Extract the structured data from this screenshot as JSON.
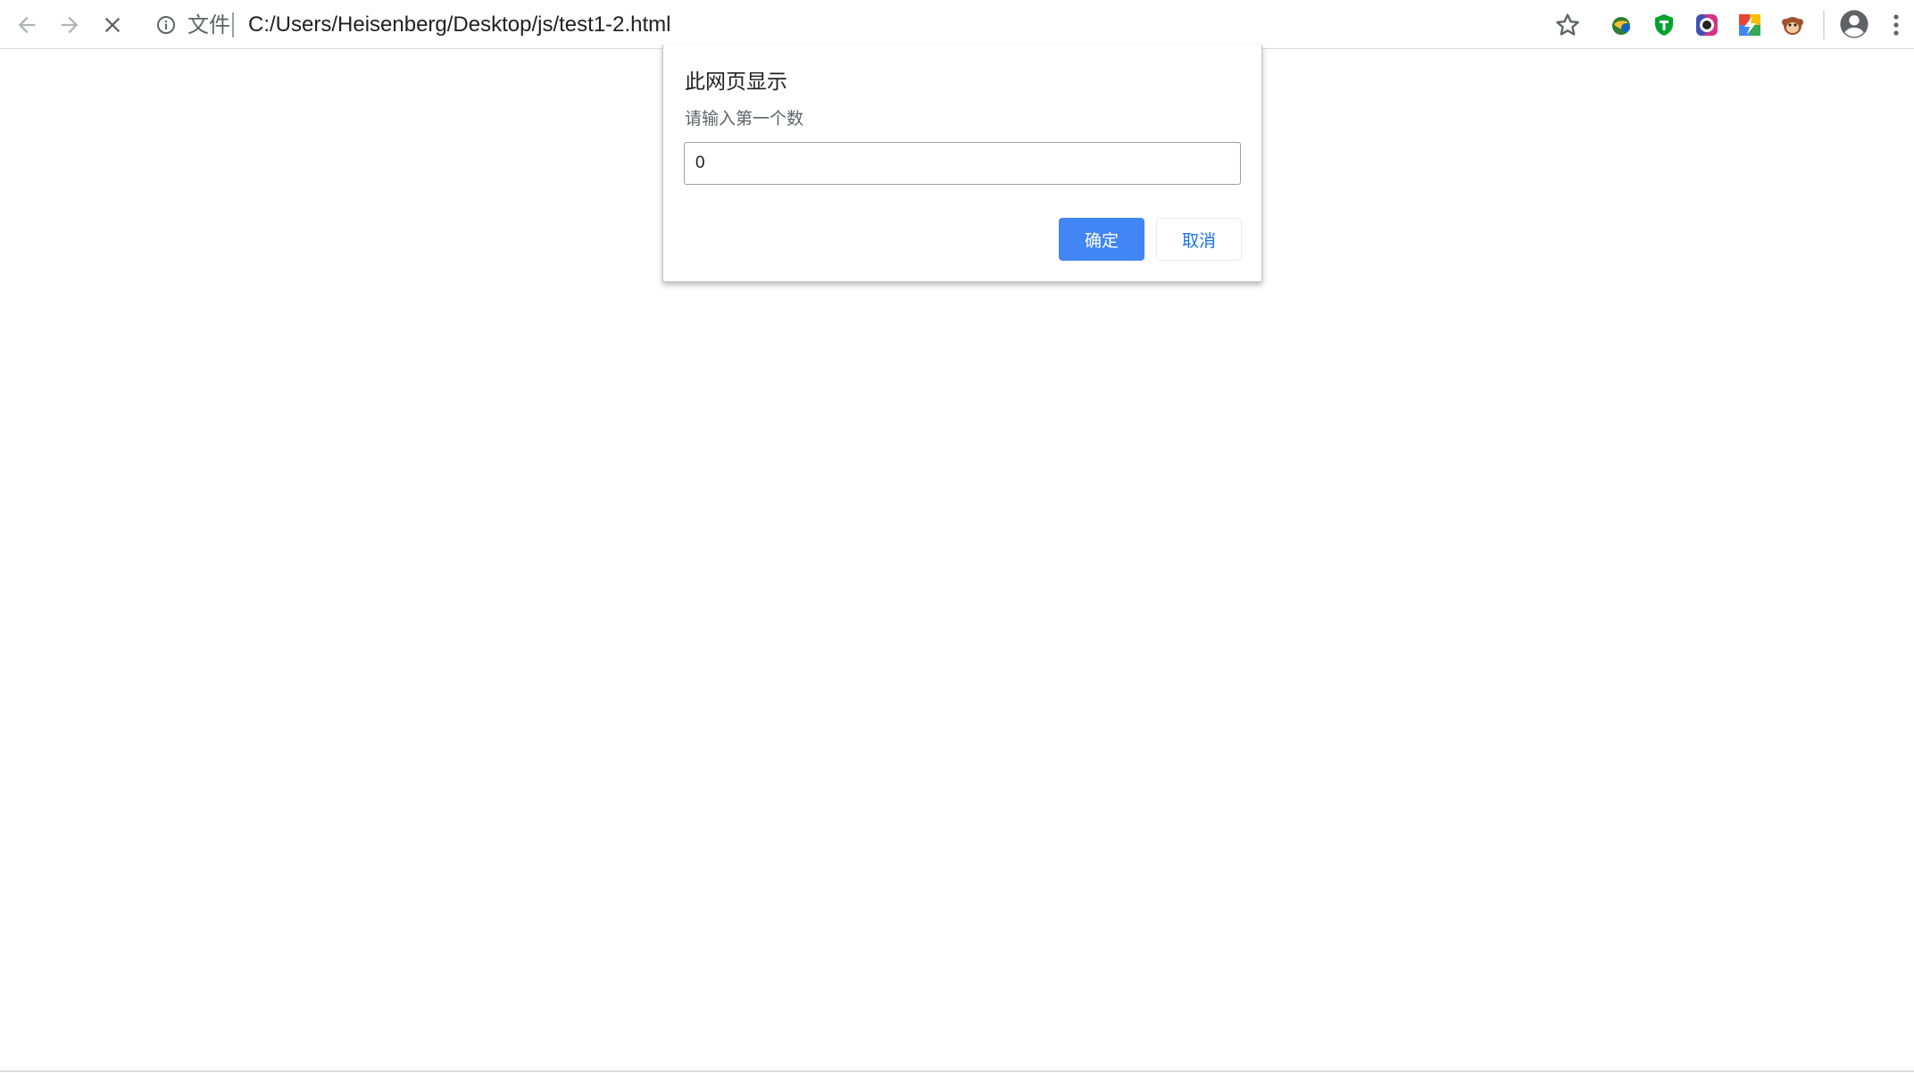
{
  "browser": {
    "url_scheme_label": "文件",
    "url": "C:/Users/Heisenberg/Desktop/js/test1-2.html",
    "nav_icons": {
      "back": "arrow-left-icon",
      "forward": "arrow-right-icon",
      "stop": "close-icon",
      "info": "info-icon"
    },
    "toolbar_icons": [
      "star-icon",
      "globe-extension-icon",
      "shield-extension-icon",
      "color-picker-extension-icon",
      "google-extension-icon",
      "monkey-extension-icon",
      "profile-icon",
      "more-vert-icon"
    ]
  },
  "dialog": {
    "title": "此网页显示",
    "message": "请输入第一个数",
    "input_value": "0",
    "ok_label": "确定",
    "cancel_label": "取消",
    "accent_color": "#4285f4"
  }
}
